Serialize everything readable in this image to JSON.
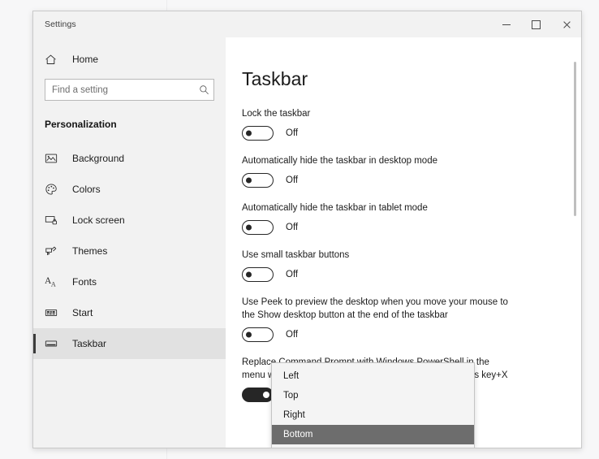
{
  "window": {
    "title": "Settings",
    "controls": {
      "minimize": "minimize",
      "maximize": "maximize",
      "close": "close"
    }
  },
  "sidebar": {
    "home_label": "Home",
    "search": {
      "placeholder": "Find a setting",
      "value": ""
    },
    "section_title": "Personalization",
    "items": [
      {
        "label": "Background",
        "icon": "image-icon",
        "selected": false
      },
      {
        "label": "Colors",
        "icon": "palette-icon",
        "selected": false
      },
      {
        "label": "Lock screen",
        "icon": "lock-screen-icon",
        "selected": false
      },
      {
        "label": "Themes",
        "icon": "themes-icon",
        "selected": false
      },
      {
        "label": "Fonts",
        "icon": "fonts-icon",
        "selected": false
      },
      {
        "label": "Start",
        "icon": "start-icon",
        "selected": false
      },
      {
        "label": "Taskbar",
        "icon": "taskbar-icon",
        "selected": true
      }
    ]
  },
  "main": {
    "title": "Taskbar",
    "settings": [
      {
        "label": "Lock the taskbar",
        "state": "Off",
        "on": false
      },
      {
        "label": "Automatically hide the taskbar in desktop mode",
        "state": "Off",
        "on": false
      },
      {
        "label": "Automatically hide the taskbar in tablet mode",
        "state": "Off",
        "on": false
      },
      {
        "label": "Use small taskbar buttons",
        "state": "Off",
        "on": false
      },
      {
        "label": "Use Peek to preview the desktop when you move your mouse to the Show desktop button at the end of the taskbar",
        "state": "Off",
        "on": false
      },
      {
        "label": "Replace Command Prompt with Windows PowerShell in the menu when I right-click the start button or press Windows key+X",
        "state": "On",
        "on": true
      }
    ]
  },
  "dropdown": {
    "options": [
      {
        "label": "Left",
        "selected": false
      },
      {
        "label": "Top",
        "selected": false
      },
      {
        "label": "Right",
        "selected": false
      },
      {
        "label": "Bottom",
        "selected": true
      }
    ]
  },
  "colors": {
    "accent_selected_bar": "#3b3b3b",
    "sidebar_bg": "#f2f2f2",
    "content_bg": "#ffffff",
    "dropdown_highlight": "#6d6d6d",
    "toggle_on_fill": "#262626"
  }
}
